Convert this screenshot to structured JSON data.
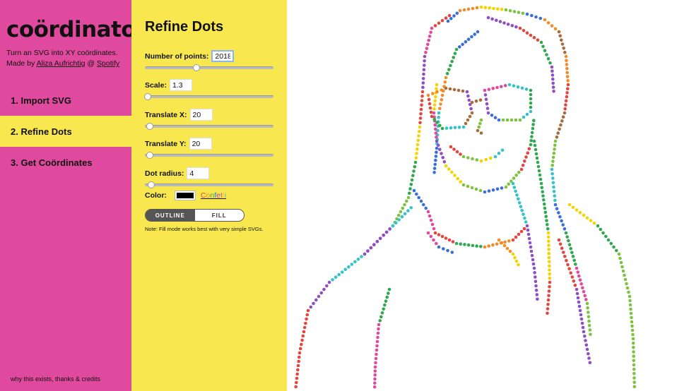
{
  "app": {
    "title": "coördinator",
    "tagline": "Turn an SVG into XY coördinates.",
    "made_by_prefix": "Made by",
    "author": "Aliza Aufrichtig",
    "at": "@",
    "company": "Spotify"
  },
  "nav": {
    "items": [
      {
        "label": "1. Import SVG"
      },
      {
        "label": "2. Refine Dots"
      },
      {
        "label": "3. Get Coördinates"
      }
    ],
    "active_index": 1
  },
  "footer": {
    "credits": "why this exists, thanks & credits"
  },
  "panel": {
    "title": "Refine Dots",
    "points": {
      "label": "Number of points:",
      "value": "2018",
      "slider": 0.4
    },
    "scale": {
      "label": "Scale:",
      "value": "1.3",
      "slider": 0.02
    },
    "translate_x": {
      "label": "Translate X:",
      "value": "20",
      "slider": 0.04
    },
    "translate_y": {
      "label": "Translate Y:",
      "value": "20",
      "slider": 0.04
    },
    "dot_radius": {
      "label": "Dot radius:",
      "value": "4",
      "slider": 0.05
    },
    "color": {
      "label": "Color:",
      "swatch": "#000000",
      "confetti_label": "Confetti"
    },
    "mode": {
      "outline": "OUTLINE",
      "fill": "FILL",
      "active": "outline"
    },
    "note": "Note: Fill mode works best with very simple SVGs."
  },
  "colors": {
    "sidebar": "#e04a9e",
    "panel": "#f8e74e",
    "confetti": [
      "#e2473f",
      "#f28c28",
      "#2fa84f",
      "#3b6fd8",
      "#8e4fc2",
      "#e04a9e",
      "#f5d300",
      "#35c2c9",
      "#7fc241",
      "#a86b3c"
    ]
  }
}
